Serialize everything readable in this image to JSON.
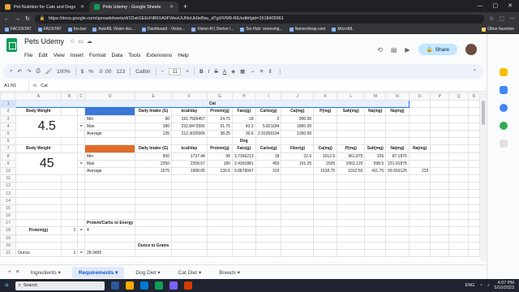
{
  "browser": {
    "tabs": [
      {
        "title": "Pet Nutrition for Cats and Dogs",
        "active": false,
        "color": "#e8a33d"
      },
      {
        "title": "Pets Udemy - Google Sheets",
        "active": true,
        "color": "#0f9d58"
      }
    ],
    "url": "https://docs.google.com/spreadsheets/d/1DskSEErFtB6XA0FWesUUNoUk0eBsu_d7gXlVM9-RE/edit#gid=1518409961",
    "bookmarks": [
      "FACOSTAT",
      "FAOSTAT",
      "foo.bar",
      "AutoML Vision doc...",
      "Dashboard - Vision...",
      "Vision AI | Derive I...",
      "Sci-Hub: removing...",
      "Namecheap.com",
      "MicroML"
    ],
    "other_bookmarks": "Other favorites"
  },
  "sheets": {
    "doc_title": "Pets Udemy",
    "menu": [
      "File",
      "Edit",
      "View",
      "Insert",
      "Format",
      "Data",
      "Tools",
      "Extensions",
      "Help"
    ],
    "share_label": "Share",
    "toolbar": {
      "zoom": "100%",
      "currency": "$",
      "percent": "%",
      "decimals": ".0  .00",
      "format": "123",
      "font": "Calibri",
      "font_size": "11"
    },
    "name_box": "A1:N1",
    "formula": "Cat",
    "columns": [
      "A",
      "B",
      "C",
      "D",
      "E",
      "F",
      "G",
      "H",
      "I",
      "J",
      "K",
      "L",
      "M",
      "N",
      "O",
      "P",
      "Q",
      "R"
    ],
    "rows": [
      {
        "n": "1",
        "cells": [
          "",
          "",
          "",
          "",
          "",
          "",
          "",
          "",
          "",
          "",
          "",
          "",
          "",
          "",
          "",
          "",
          "",
          ""
        ]
      },
      {
        "n": "2",
        "cells": [
          "Body Weight",
          "",
          "",
          "",
          "Daily Intake (G)",
          "kcal/day",
          "Protein(g)",
          "Fats(g)",
          "Carbs(g)",
          "Ca(mg)",
          "P(mg)",
          "Salt(mg)",
          "Na(mg)",
          "Na(mg)",
          "",
          "",
          "",
          ""
        ]
      },
      {
        "n": "3",
        "cells": [
          "",
          "",
          "",
          "Min",
          "90",
          "191.7566457",
          "24.75",
          "18",
          "0",
          "900.00",
          "",
          "",
          "",
          "",
          "",
          "",
          "",
          ""
        ]
      },
      {
        "n": "4",
        "cells": [
          "",
          "",
          "=",
          "Max",
          "180",
          "232.8473555",
          "51.75",
          "43.2",
          "5.821184",
          "1800.00",
          "",
          "",
          "",
          "",
          "",
          "",
          "",
          ""
        ]
      },
      {
        "n": "5",
        "cells": [
          "",
          "",
          "",
          "Average",
          "135",
          "212.3020006",
          "38.25",
          "30.6",
          "2.91059194",
          "1350.00",
          "",
          "",
          "",
          "",
          "",
          "",
          "",
          ""
        ]
      },
      {
        "n": "6",
        "cells": [
          "",
          "",
          "",
          "",
          "",
          "",
          "",
          "Dog",
          "",
          "",
          "",
          "",
          "",
          "",
          "",
          "",
          "",
          ""
        ]
      },
      {
        "n": "7",
        "cells": [
          "Body Weight",
          "",
          "",
          "",
          "Daily Intake (G)",
          "kcal/day",
          "Protein(g)",
          "Fats(g)",
          "Carbs(g)",
          "Fiber(g)",
          "Ca(mg)",
          "P(mg)",
          "Salt(mg)",
          "Na(mg)",
          "Na(mg)",
          "",
          "",
          ""
        ]
      },
      {
        "n": "8",
        "cells": [
          "",
          "",
          "",
          "Min",
          "900",
          "1737.44",
          "99",
          "3.7366213",
          "18",
          "22.5",
          "1012.5",
          "961.875",
          "225",
          "87.1875",
          "",
          "",
          "",
          ""
        ]
      },
      {
        "n": "9",
        "cells": [
          "",
          "",
          "=",
          "Max",
          "2250",
          "2258.67",
          "180",
          "2.4391881",
          "450",
          "101.25",
          "2025",
          "1063.125",
          "598.5",
          "231.91875",
          "",
          "",
          "",
          ""
        ]
      },
      {
        "n": "10",
        "cells": [
          "",
          "",
          "",
          "Average",
          "1575",
          "1998.05",
          "139.5",
          "9.0879047",
          "315",
          "",
          "1518.75",
          "1012.50",
          "411.75",
          "59.553125",
          "225",
          "",
          "",
          ""
        ]
      },
      {
        "n": "11",
        "cells": [
          "",
          "",
          "",
          "",
          "",
          "",
          "",
          "",
          "",
          "",
          "",
          "",
          "",
          "",
          "",
          "",
          "",
          ""
        ]
      },
      {
        "n": "12",
        "cells": [
          "",
          "",
          "",
          "",
          "",
          "",
          "",
          "",
          "",
          "",
          "",
          "",
          "",
          "",
          "",
          "",
          "",
          ""
        ]
      },
      {
        "n": "13",
        "cells": [
          "",
          "",
          "",
          "",
          "",
          "",
          "",
          "",
          "",
          "",
          "",
          "",
          "",
          "",
          "",
          "",
          "",
          ""
        ]
      },
      {
        "n": "14",
        "cells": [
          "",
          "",
          "",
          "",
          "",
          "",
          "",
          "",
          "",
          "",
          "",
          "",
          "",
          "",
          "",
          "",
          "",
          ""
        ]
      },
      {
        "n": "15",
        "cells": [
          "",
          "",
          "",
          "",
          "",
          "",
          "",
          "",
          "",
          "",
          "",
          "",
          "",
          "",
          "",
          "",
          "",
          ""
        ]
      },
      {
        "n": "16",
        "cells": [
          "",
          "",
          "",
          "",
          "",
          "",
          "",
          "",
          "",
          "",
          "",
          "",
          "",
          "",
          "",
          "",
          "",
          ""
        ]
      },
      {
        "n": "17",
        "cells": [
          "",
          "",
          "",
          "Protein/Carbs to Energy",
          "",
          "",
          "",
          "",
          "",
          "",
          "",
          "",
          "",
          "",
          "",
          "",
          "",
          ""
        ]
      },
      {
        "n": "18",
        "cells": [
          "Protein(g)",
          "1",
          "=",
          "4",
          "",
          "",
          "",
          "",
          "",
          "",
          "",
          "",
          "",
          "",
          "",
          "",
          "",
          ""
        ]
      },
      {
        "n": "19",
        "cells": [
          "",
          "",
          "",
          "",
          "",
          "",
          "",
          "",
          "",
          "",
          "",
          "",
          "",
          "",
          "",
          "",
          "",
          ""
        ]
      },
      {
        "n": "20",
        "cells": [
          "",
          "",
          "",
          "",
          "Ounce to Grams",
          "",
          "",
          "",
          "",
          "",
          "",
          "",
          "",
          "",
          "",
          "",
          "",
          ""
        ]
      },
      {
        "n": "21",
        "cells": [
          "Ounce",
          "1",
          "=",
          "28.3495",
          "",
          "",
          "",
          "",
          "",
          "",
          "",
          "",
          "",
          "",
          "",
          "",
          "",
          ""
        ]
      }
    ],
    "merged": {
      "cat_title": "Cat",
      "cat_weight": "4.5",
      "dog_weight": "45"
    },
    "sheet_tabs": [
      "Ingredients",
      "Requirements",
      "Dog Diet",
      "Cat Diet",
      "Breeds"
    ],
    "active_tab": "Requirements"
  },
  "taskbar": {
    "search_placeholder": "Search",
    "lang": "ENG",
    "time": "4:07 PM",
    "date": "5/10/2023"
  },
  "colors": {
    "cat_swatch": "#3c78d8",
    "dog_swatch": "#e06c2c",
    "selection": "#1a73e8"
  }
}
